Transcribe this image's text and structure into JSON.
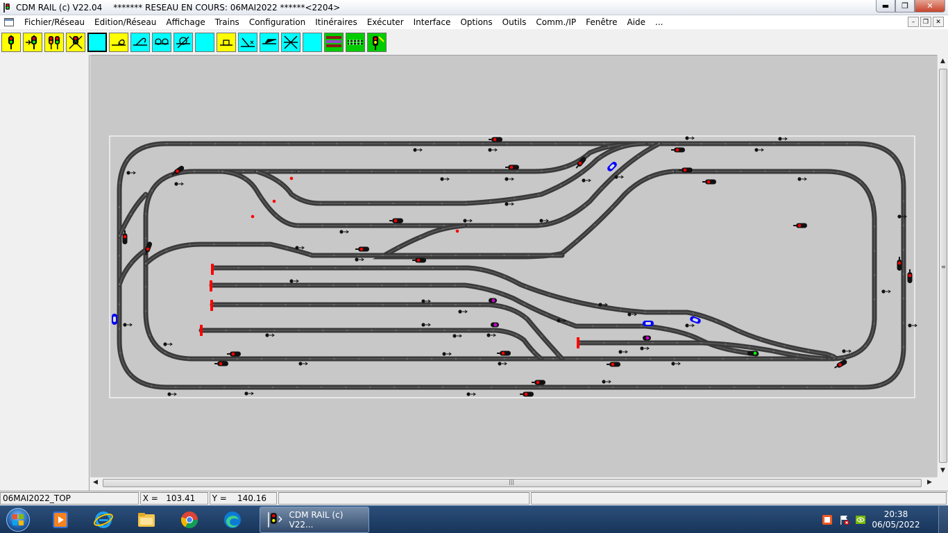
{
  "window": {
    "title": "CDM RAIL (c) V22.04",
    "network_status": "******* RESEAU EN COURS: 06MAI2022 ******<2204>",
    "controls": [
      "minimize",
      "maximize",
      "close"
    ]
  },
  "menu": {
    "items": [
      "Fichier/Réseau",
      "Edition/Réseau",
      "Affichage",
      "Trains",
      "Configuration",
      "Itinéraires",
      "Exécuter",
      "Interface",
      "Options",
      "Outils",
      "Comm./IP",
      "Fenêtre",
      "Aide",
      "..."
    ]
  },
  "toolbar": {
    "buttons": [
      {
        "icon": "signal-icon",
        "color": "#ffff00"
      },
      {
        "icon": "signal-arrow-icon",
        "color": "#ffff00"
      },
      {
        "icon": "double-signal-icon",
        "color": "#ffff00"
      },
      {
        "icon": "signal-cross-icon",
        "color": "#ffff00"
      },
      {
        "icon": "blank-icon",
        "color": "#00ffff",
        "selected": true
      },
      {
        "icon": "loop-icon",
        "color": "#ffff00"
      },
      {
        "icon": "turnout-loop-icon",
        "color": "#00ffff"
      },
      {
        "icon": "double-loop-icon",
        "color": "#00ffff"
      },
      {
        "icon": "crossed-loop-icon",
        "color": "#00ffff"
      },
      {
        "icon": "blank-icon",
        "color": "#00ffff"
      },
      {
        "icon": "platform-icon",
        "color": "#ffff00"
      },
      {
        "icon": "turnout-icon",
        "color": "#00ffff"
      },
      {
        "icon": "turnout-pair-icon",
        "color": "#00ffff"
      },
      {
        "icon": "crossing-icon",
        "color": "#00ffff"
      },
      {
        "icon": "blank-icon",
        "color": "#00ffff"
      },
      {
        "icon": "colored-lines-icon",
        "color": "#00cc00"
      },
      {
        "icon": "track-icon",
        "color": "#00cc00"
      },
      {
        "icon": "signal-wand-icon",
        "color": "#00cc00"
      }
    ]
  },
  "status": {
    "network_name": "06MAI2022_TOP",
    "x_label": "X =",
    "x_value": "103.41",
    "y_label": "Y =",
    "y_value": "140.16"
  },
  "taskbar": {
    "apps": [
      "media-player-icon",
      "internet-explorer-icon",
      "file-explorer-icon",
      "chrome-icon",
      "edge-icon"
    ],
    "active_task": "CDM RAIL (c) V22...",
    "time": "20:38",
    "date": "06/05/2022"
  },
  "colors": {
    "canvas_bg": "#c8c8c8",
    "plan_bg": "#c8c8c8",
    "track": "#3a3a3a",
    "buffer_stop": "#ff0000",
    "signal_red": "#ff0000",
    "signal_green": "#00ff00",
    "train_blue": "#0000ff",
    "train_magenta": "#cc00cc"
  }
}
